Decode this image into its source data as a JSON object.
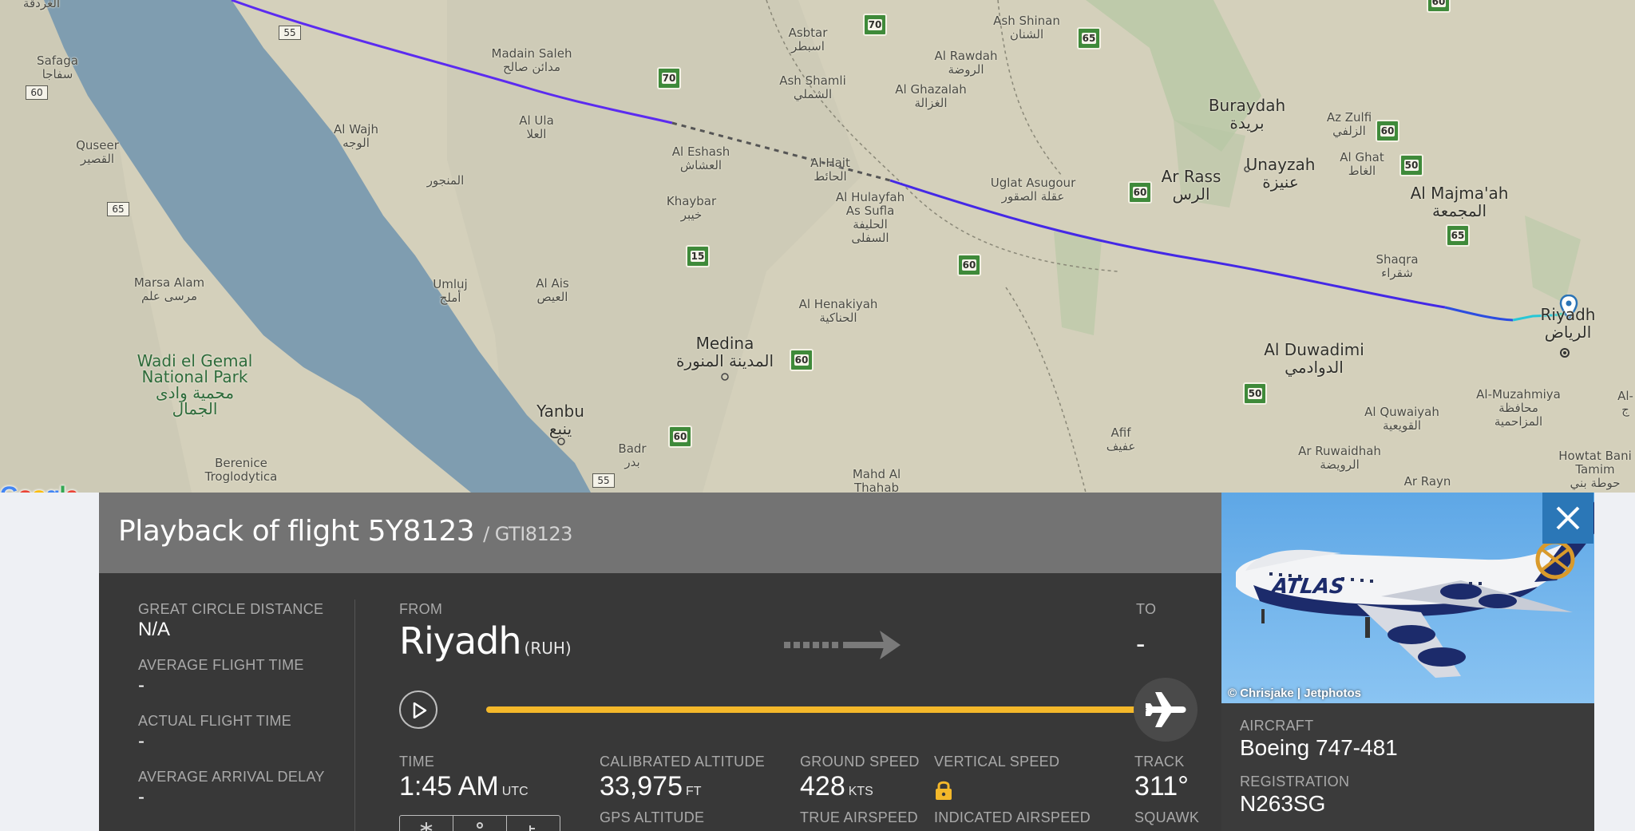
{
  "map": {
    "places": [
      {
        "id": "hurghada",
        "text": "الغردقة"
      },
      {
        "id": "safaga",
        "text": "Safaga\nسفاجا"
      },
      {
        "id": "quseer",
        "text": "Quseer\nالقصير"
      },
      {
        "id": "marsa_alam",
        "text": "Marsa Alam\nمرسى علم"
      },
      {
        "id": "wadi_gemal",
        "text": "Wadi el Gemal\nNational Park\nمحمية وادى\nالجمال"
      },
      {
        "id": "berenice",
        "text": "Berenice\nTroglodytica"
      },
      {
        "id": "madain_saleh",
        "text": "Madain Saleh\nمدائن صالح"
      },
      {
        "id": "al_ula",
        "text": "Al Ula\nالعلا"
      },
      {
        "id": "al_wajh",
        "text": "Al Wajh\nالوجه"
      },
      {
        "id": "al_muntajar",
        "text": "المنجور"
      },
      {
        "id": "umluj",
        "text": "Umluj\nأملج"
      },
      {
        "id": "al_ais",
        "text": "Al Ais\nالعيص"
      },
      {
        "id": "yanbu",
        "text": "Yanbu\nينبع"
      },
      {
        "id": "badr",
        "text": "Badr\nبدر"
      },
      {
        "id": "medina",
        "text": "Medina\nالمدينة المنورة"
      },
      {
        "id": "khaybar",
        "text": "Khaybar\nخيبر"
      },
      {
        "id": "al_eshash",
        "text": "Al Eshash\nالعشاش"
      },
      {
        "id": "asbtar",
        "text": "Asbtar\nاسبطر"
      },
      {
        "id": "ash_shamli",
        "text": "Ash Shamli\nالشملي"
      },
      {
        "id": "al_hait",
        "text": "Al Hait\nالحائط"
      },
      {
        "id": "al_hulayfah",
        "text": "Al Hulayfah\nAs Sufla\nالحليفة\nالسفلى"
      },
      {
        "id": "al_henakiyah",
        "text": "Al Henakiyah\nالحناكية"
      },
      {
        "id": "mahd_al_thahab",
        "text": "Mahd Al\nThahab"
      },
      {
        "id": "al_rawdah",
        "text": "Al Rawdah\nالروضة"
      },
      {
        "id": "al_ghazalah",
        "text": "Al Ghazalah\nالغزالة"
      },
      {
        "id": "ash_shinan",
        "text": "Ash Shinan\nالشنان"
      },
      {
        "id": "uglat_asugour",
        "text": "Uglat Asugour\nعقلة الصقور"
      },
      {
        "id": "buraydah",
        "text": "Buraydah\nبريدة"
      },
      {
        "id": "ar_rass",
        "text": "Ar Rass\nالرس"
      },
      {
        "id": "unayzah",
        "text": "Unayzah\nعنيزة"
      },
      {
        "id": "az_zulfi",
        "text": "Az Zulfi\nالزلفي"
      },
      {
        "id": "al_ghat",
        "text": "Al Ghat\nالغاط"
      },
      {
        "id": "al_majmaah",
        "text": "Al Majma'ah\nالمجمعة"
      },
      {
        "id": "shaqra",
        "text": "Shaqra\nشقراء"
      },
      {
        "id": "riyadh",
        "text": "Riyadh\nالرياض"
      },
      {
        "id": "al_duwadimi",
        "text": "Al Duwadimi\nالدوادمي"
      },
      {
        "id": "afif",
        "text": "Afif\nعفيف"
      },
      {
        "id": "al_quwaiyah",
        "text": "Al Quwaiyah\nالقويعية"
      },
      {
        "id": "al_muzahmiya",
        "text": "Al-Muzahmiya\nمحافظة\nالمزاحمية"
      },
      {
        "id": "ar_ruwaidhah",
        "text": "Ar Ruwaidhah\nالرويضة"
      },
      {
        "id": "ar_rayn",
        "text": "Ar Rayn"
      },
      {
        "id": "howtat_bani_tamim",
        "text": "Howtat Bani\nTamim\nحوطة بني"
      },
      {
        "id": "al_edge",
        "text": "Al-\nج"
      }
    ],
    "green_shields": [
      "70",
      "70",
      "65",
      "60",
      "50",
      "65",
      "60",
      "60",
      "15",
      "60",
      "60",
      "50",
      "60"
    ],
    "road_labels": [
      "55",
      "60",
      "65",
      "55"
    ],
    "google_logo": "Google",
    "edge_fragment": "Te"
  },
  "panel": {
    "title": "Playback of flight 5Y8123",
    "callsign": "/ GTI8123",
    "stats": [
      {
        "label": "GREAT CIRCLE DISTANCE",
        "value": "N/A"
      },
      {
        "label": "AVERAGE FLIGHT TIME",
        "value": "-"
      },
      {
        "label": "ACTUAL FLIGHT TIME",
        "value": "-"
      },
      {
        "label": "AVERAGE ARRIVAL DELAY",
        "value": "-"
      }
    ],
    "from_label": "FROM",
    "from_city": "Riyadh",
    "from_code": "(RUH)",
    "to_label": "TO",
    "to_value": "-",
    "progress_fraction": 0.97,
    "time_label": "TIME",
    "time_value": "1:45 AM",
    "time_unit": "UTC",
    "cal_alt_label": "CALIBRATED ALTITUDE",
    "cal_alt_value": "33,975",
    "cal_alt_unit": "FT",
    "gps_alt_label": "GPS ALTITUDE",
    "ground_speed_label": "GROUND SPEED",
    "ground_speed_value": "428",
    "ground_speed_unit": "KTS",
    "true_airspeed_label": "TRUE AIRSPEED",
    "vertical_speed_label": "VERTICAL SPEED",
    "indicated_airspeed_label": "INDICATED AIRSPEED",
    "track_label": "TRACK",
    "track_value": "311°",
    "squawk_label": "SQUAWK"
  },
  "photo": {
    "airline_text": "ATLAS",
    "credit": "© Chrisjake | Jetphotos"
  },
  "aircraft": {
    "aircraft_label": "AIRCRAFT",
    "aircraft_value": "Boeing 747-481",
    "registration_label": "REGISTRATION",
    "registration_value": "N263SG"
  },
  "colors": {
    "track_purple": "#5b2bf0",
    "track_blue": "#2c4de0",
    "track_cyan": "#27c7d6",
    "progress": "#f4b82a",
    "close_button": "#2b77b7"
  },
  "icons": [
    "play-icon",
    "airplane-icon",
    "close-icon",
    "route-arrow-icon",
    "lock-icon",
    "location-pin-icon",
    "settings-icon",
    "share-icon",
    "filter-icon"
  ]
}
